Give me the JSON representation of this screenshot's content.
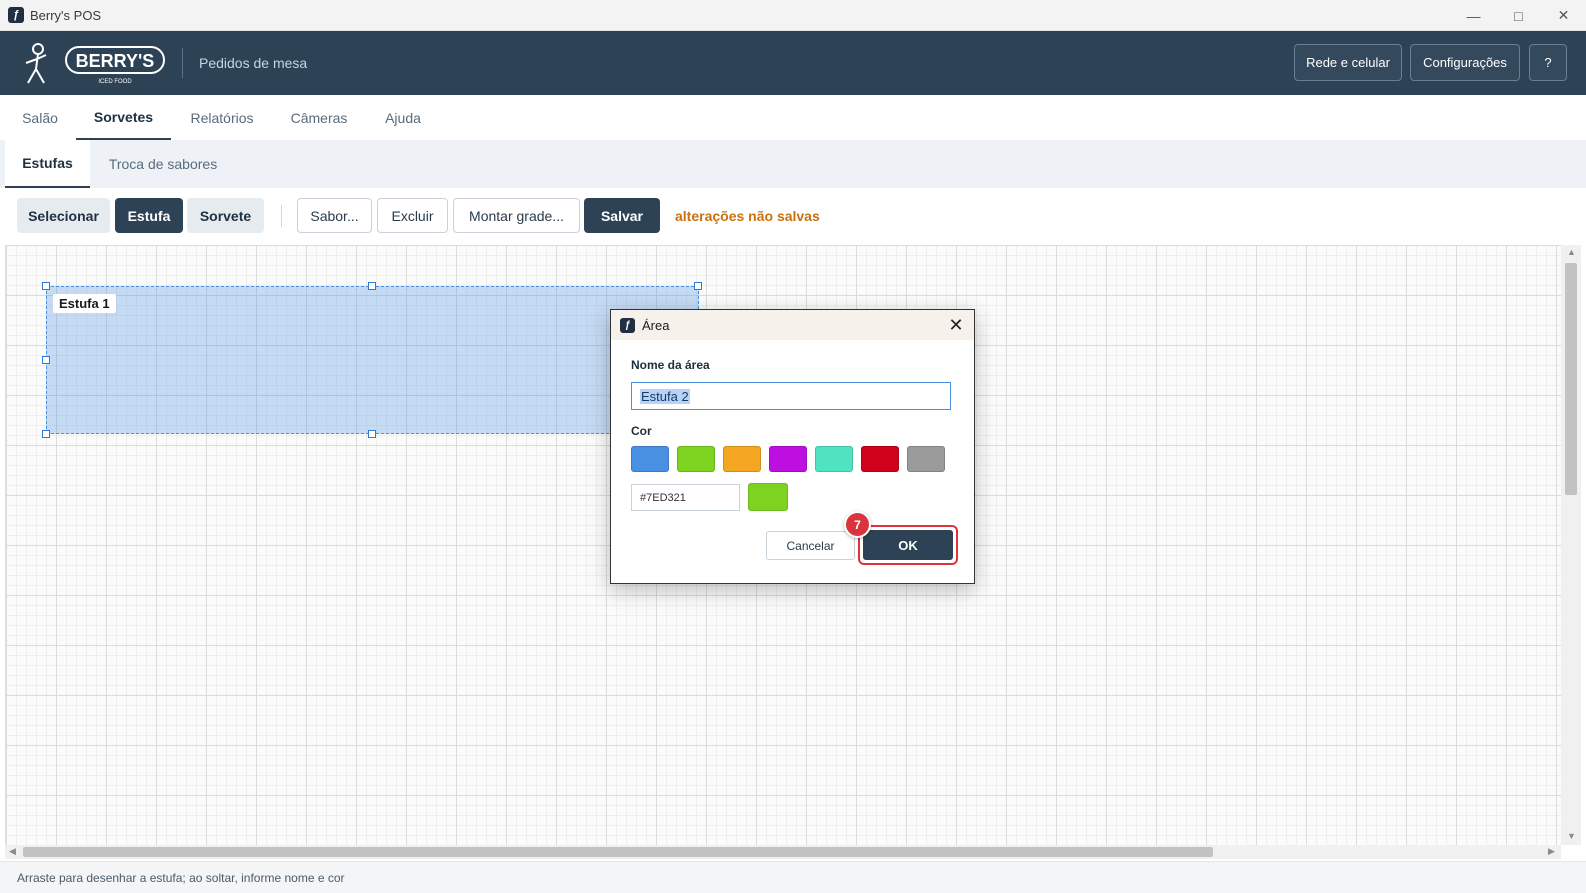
{
  "window": {
    "title": "Berry's POS"
  },
  "header": {
    "logo_text": "BERRY'S",
    "logo_sub": "ICED FOOD",
    "subtitle": "Pedidos de mesa",
    "buttons": {
      "network": "Rede e celular",
      "settings": "Configurações",
      "help": "?"
    }
  },
  "main_tabs": [
    "Salão",
    "Sorvetes",
    "Relatórios",
    "Câmeras",
    "Ajuda"
  ],
  "main_tab_active": "Sorvetes",
  "sub_tabs": [
    "Estufas",
    "Troca de sabores"
  ],
  "sub_tab_active": "Estufas",
  "toolbar": {
    "modes": [
      "Selecionar",
      "Estufa",
      "Sorvete"
    ],
    "active_mode": "Estufa",
    "actions": [
      "Sabor...",
      "Excluir",
      "Montar grade..."
    ],
    "save": "Salvar",
    "unsaved_notice": "alterações não salvas"
  },
  "canvas": {
    "areas": [
      {
        "name": "Estufa 1",
        "color": "#4A90E2"
      }
    ]
  },
  "dialog": {
    "title": "Área",
    "name_label": "Nome da área",
    "name_value": "Estufa 2",
    "color_label": "Cor",
    "swatches": [
      "#4A90E2",
      "#7ED321",
      "#F5A623",
      "#BD10E0",
      "#50E3C2",
      "#D0021B",
      "#9B9B9B"
    ],
    "hex_value": "#7ED321",
    "preview_color": "#7ED321",
    "cancel": "Cancelar",
    "ok": "OK",
    "step_badge": "7"
  },
  "status": {
    "hint": "Arraste para desenhar a estufa; ao soltar, informe nome e cor"
  }
}
